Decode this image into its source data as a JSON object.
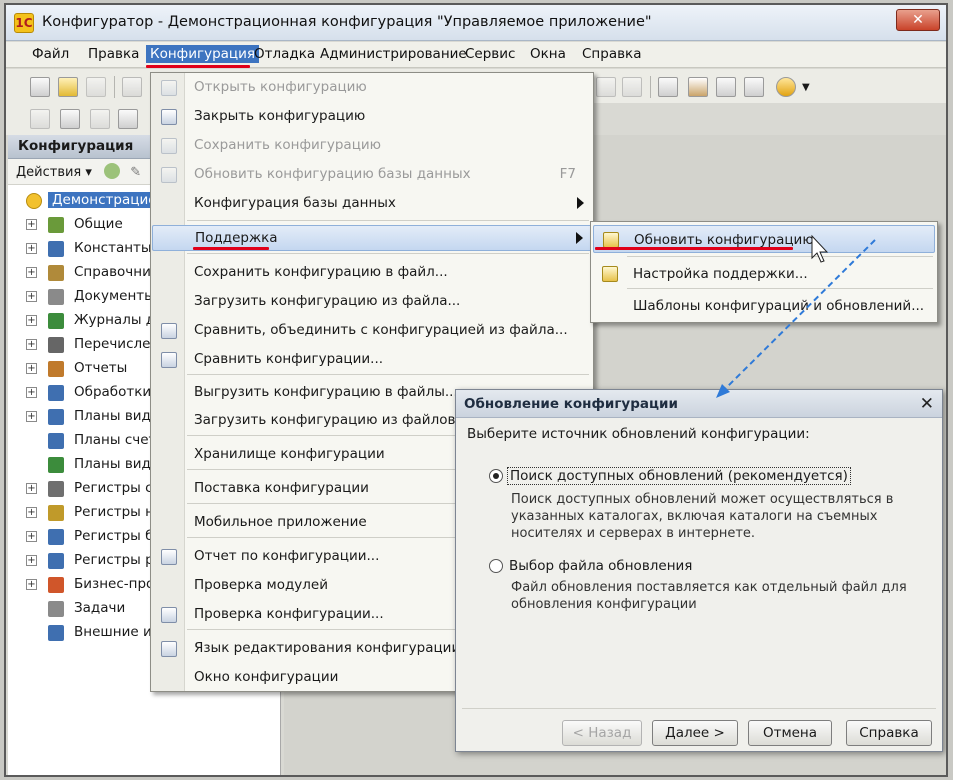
{
  "window": {
    "title": "Конфигуратор - Демонстрационная конфигурация \"Управляемое приложение\"",
    "close_glyph": "✕"
  },
  "menubar": [
    "Файл",
    "Правка",
    "Конфигурация",
    "Отладка",
    "Администрирование",
    "Сервис",
    "Окна",
    "Справка"
  ],
  "left_panel": {
    "title": "Конфигурация",
    "actions_label": "Действия ▾",
    "tree_root": "Демонстрацион",
    "tree_items": [
      {
        "label": "Общие",
        "icon": "common-icon",
        "color": "#6a9a3a",
        "expandable": true
      },
      {
        "label": "Константы",
        "icon": "constants-icon",
        "color": "#3f6fb0",
        "expandable": true
      },
      {
        "label": "Справочник",
        "icon": "catalog-icon",
        "color": "#b08a3a",
        "expandable": true
      },
      {
        "label": "Документы",
        "icon": "documents-icon",
        "color": "#8a8a8a",
        "expandable": true
      },
      {
        "label": "Журналы до",
        "icon": "journals-icon",
        "color": "#3c8c3c",
        "expandable": true
      },
      {
        "label": "Перечислен",
        "icon": "enums-icon",
        "color": "#666666",
        "expandable": true
      },
      {
        "label": "Отчеты",
        "icon": "reports-icon",
        "color": "#c07a2c",
        "expandable": true
      },
      {
        "label": "Обработки",
        "icon": "processing-icon",
        "color": "#3f6fb0",
        "expandable": true
      },
      {
        "label": "Планы видо",
        "icon": "chart-of-characteristics-icon",
        "color": "#3f6fb0",
        "expandable": true
      },
      {
        "label": "Планы счето",
        "icon": "chart-of-accounts-icon",
        "color": "#3f6fb0",
        "expandable": false
      },
      {
        "label": "Планы видо",
        "icon": "chart-of-calculation-icon",
        "color": "#3c8c3c",
        "expandable": false
      },
      {
        "label": "Регистры св",
        "icon": "info-registers-icon",
        "color": "#6f6f6f",
        "expandable": true
      },
      {
        "label": "Регистры на",
        "icon": "accumulation-registers-icon",
        "color": "#c09a2a",
        "expandable": true
      },
      {
        "label": "Регистры бу",
        "icon": "accounting-registers-icon",
        "color": "#3f6fb0",
        "expandable": true
      },
      {
        "label": "Регистры ра",
        "icon": "calculation-registers-icon",
        "color": "#3f6fb0",
        "expandable": true
      },
      {
        "label": "Бизнес-проц",
        "icon": "business-process-icon",
        "color": "#d0562a",
        "expandable": true
      },
      {
        "label": "Задачи",
        "icon": "tasks-icon",
        "color": "#8a8a8a",
        "expandable": false
      },
      {
        "label": "Внешние ис",
        "icon": "external-sources-icon",
        "color": "#3f6fb0",
        "expandable": false
      }
    ]
  },
  "config_menu": {
    "items": [
      {
        "label": "Открыть конфигурацию",
        "disabled": true,
        "icon": "open-config-icon"
      },
      {
        "label": "Закрыть конфигурацию",
        "disabled": false,
        "icon": "close-config-icon"
      },
      {
        "label": "Сохранить конфигурацию",
        "disabled": true,
        "icon": "save-config-icon"
      },
      {
        "label": "Обновить конфигурацию базы данных",
        "disabled": true,
        "icon": "update-db-icon",
        "shortcut": "F7"
      },
      {
        "label": "Конфигурация базы данных",
        "disabled": false,
        "submenu": true
      },
      {
        "label": "Поддержка",
        "disabled": false,
        "submenu": true,
        "highlighted": true
      },
      {
        "label": "Сохранить конфигурацию в файл...",
        "disabled": false
      },
      {
        "label": "Загрузить конфигурацию из файла...",
        "disabled": false
      },
      {
        "label": "Сравнить, объединить с конфигурацией из файла...",
        "disabled": false,
        "icon": "compare-merge-icon"
      },
      {
        "label": "Сравнить конфигурации...",
        "disabled": false,
        "icon": "compare-icon"
      },
      {
        "label": "Выгрузить конфигурацию в файлы...",
        "disabled": false
      },
      {
        "label": "Загрузить конфигурацию из файлов...",
        "disabled": false
      },
      {
        "label": "Хранилище конфигурации",
        "disabled": false,
        "submenu": true
      },
      {
        "label": "Поставка конфигурации",
        "disabled": false,
        "submenu": true
      },
      {
        "label": "Мобильное приложение",
        "disabled": false,
        "submenu": true
      },
      {
        "label": "Отчет по конфигурации...",
        "disabled": false,
        "icon": "report-icon"
      },
      {
        "label": "Проверка модулей",
        "disabled": false
      },
      {
        "label": "Проверка конфигурации...",
        "disabled": false,
        "icon": "check-config-icon"
      },
      {
        "label": "Язык редактирования конфигурации...",
        "disabled": false,
        "icon": "abc-icon"
      },
      {
        "label": "Окно конфигурации",
        "disabled": false
      }
    ]
  },
  "support_submenu": {
    "items": [
      {
        "label": "Обновить конфигурацию",
        "highlighted": true,
        "icon": "update-config-icon"
      },
      {
        "label": "Настройка поддержки...",
        "icon": "support-settings-icon"
      },
      {
        "label": "Шаблоны конфигураций и обновлений..."
      }
    ]
  },
  "dialog": {
    "title": "Обновление конфигурации",
    "close_glyph": "✕",
    "prompt": "Выберите источник обновлений конфигурации:",
    "option1_label": "Поиск доступных обновлений (рекомендуется)",
    "option1_desc": "Поиск доступных обновлений может осуществляться в указанных каталогах, включая каталоги на съемных носителях и серверах в интернете.",
    "option2_label": "Выбор файла обновления",
    "option2_desc": "Файл обновления поставляется как отдельный файл для обновления конфигурации",
    "selected_option": 1,
    "buttons": {
      "back": "< Назад",
      "next": "Далее >",
      "cancel": "Отмена",
      "help": "Справка"
    }
  },
  "colors": {
    "annotation_red": "#e0001a",
    "annotation_arrow": "#2f7ad8",
    "selection_blue": "#3d74c0"
  }
}
